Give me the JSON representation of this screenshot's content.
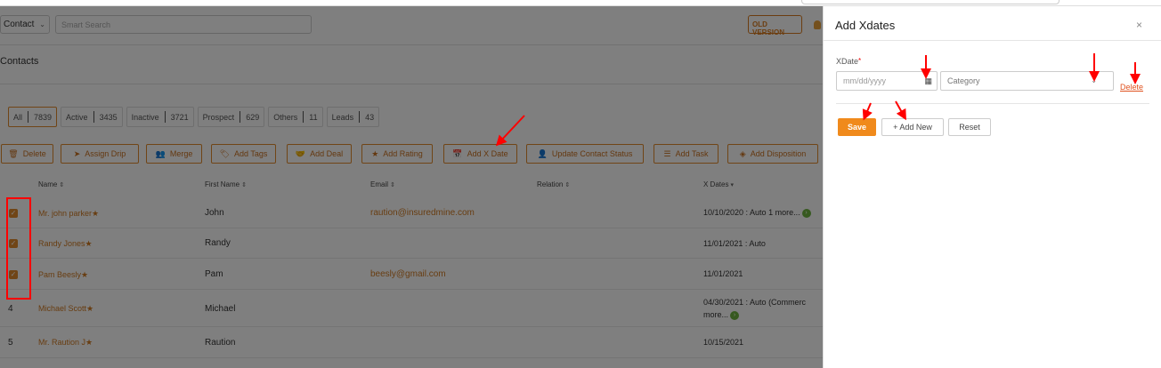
{
  "header": {
    "entity_select": "Contact",
    "search_placeholder": "Smart Search",
    "old_version_label": "OLD VERSION"
  },
  "page_title": "Contacts",
  "filters": [
    {
      "label": "All",
      "count": "7839"
    },
    {
      "label": "Active",
      "count": "3435"
    },
    {
      "label": "Inactive",
      "count": "3721"
    },
    {
      "label": "Prospect",
      "count": "629"
    },
    {
      "label": "Others",
      "count": "11"
    },
    {
      "label": "Leads",
      "count": "43"
    }
  ],
  "actions": [
    {
      "label": "Delete",
      "icon": "trash-icon"
    },
    {
      "label": "Assign Drip",
      "icon": "send-icon"
    },
    {
      "label": "Merge",
      "icon": "users-icon"
    },
    {
      "label": "Add Tags",
      "icon": "tag-icon"
    },
    {
      "label": "Add Deal",
      "icon": "handshake-icon"
    },
    {
      "label": "Add Rating",
      "icon": "star-icon"
    },
    {
      "label": "Add X Date",
      "icon": "calendar-icon"
    },
    {
      "label": "Update Contact Status",
      "icon": "user-edit-icon"
    },
    {
      "label": "Add Task",
      "icon": "list-icon"
    },
    {
      "label": "Add Disposition",
      "icon": "layers-icon"
    }
  ],
  "table": {
    "columns": [
      "Name",
      "First Name",
      "Email",
      "Relation",
      "X Dates"
    ],
    "rows": [
      {
        "index": "",
        "checked": true,
        "name": "Mr. john parker",
        "first_name": "John",
        "email": "raution@insuredmine.com",
        "relation": "",
        "xdates": "10/10/2020 : Auto 1 more...",
        "xdates2": ""
      },
      {
        "index": "",
        "checked": true,
        "name": "Randy Jones",
        "first_name": "Randy",
        "email": "",
        "relation": "",
        "xdates": "11/01/2021 : Auto",
        "xdates2": ""
      },
      {
        "index": "",
        "checked": true,
        "name": "Pam Beesly",
        "first_name": "Pam",
        "email": "beesly@gmail.com",
        "relation": "",
        "xdates": "11/01/2021",
        "xdates2": ""
      },
      {
        "index": "4",
        "checked": false,
        "name": "Michael Scott",
        "first_name": "Michael",
        "email": "",
        "relation": "",
        "xdates": "04/30/2021 : Auto (Commerc",
        "xdates2": "more..."
      },
      {
        "index": "5",
        "checked": false,
        "name": "Mr. Raution J",
        "first_name": "Raution",
        "email": "",
        "relation": "",
        "xdates": "10/15/2021",
        "xdates2": ""
      }
    ]
  },
  "panel": {
    "title": "Add Xdates",
    "xdate_label": "XDate",
    "required_mark": "*",
    "date_placeholder": "mm/dd/yyyy",
    "category_placeholder": "Category",
    "delete_label": "Delete",
    "save_label": "Save",
    "add_new_label": "+ Add New",
    "reset_label": "Reset",
    "close_glyph": "×"
  },
  "colors": {
    "accent": "#e08a2c",
    "save": "#f08a1c",
    "annotation": "#ff0000"
  }
}
